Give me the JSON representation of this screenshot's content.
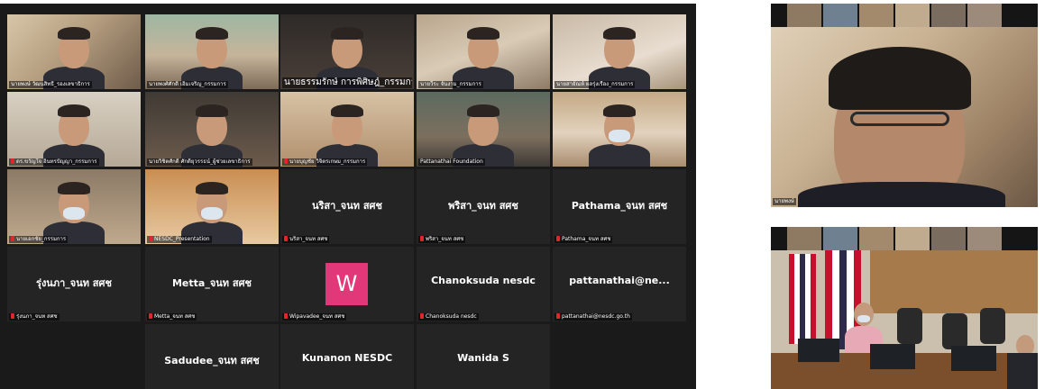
{
  "gallery": {
    "tiles": [
      {
        "type": "video",
        "bg": "vbg-a",
        "name": "นายพงษ์ วัฒนสิทธิ์_รองเลขาธิการ",
        "active": true
      },
      {
        "type": "video",
        "bg": "vbg-b",
        "name": "นายพงศ์ศักดิ์ เอิ่มเจริญ_กรรมการ"
      },
      {
        "type": "video",
        "bg": "vbg-c",
        "name": "นายธรรมรักษ์ การพิศิษฎ์_กรรมการ",
        "big": true
      },
      {
        "type": "video",
        "bg": "vbg-d",
        "name": "นายวีระ จั่นงาม_กรรมการ"
      },
      {
        "type": "video",
        "bg": "vbg-e",
        "name": "นายสายัณห์ ผลรุ่งเรือง_กรรมการ"
      },
      {
        "type": "video",
        "bg": "vbg-f",
        "name": "ดร.ขวัญใจ อินทรปัญญา_กรรมการ",
        "mic": true
      },
      {
        "type": "video",
        "bg": "vbg-g",
        "name": "นายวิชิตศักดิ์ ศักดิ์ยุวรรธน์_ผู้ช่วยเลขาธิการ"
      },
      {
        "type": "video",
        "bg": "vbg-h",
        "name": "นายบุญชัย วิจิตรเกษม_กรรมการ",
        "mic": true
      },
      {
        "type": "video",
        "bg": "vbg-i",
        "name": "Pattanathai Foundation"
      },
      {
        "type": "video",
        "bg": "vbg-j",
        "name": "",
        "masked": true
      },
      {
        "type": "video",
        "bg": "vbg-k",
        "name": "นายเอกชัย_กรรมการ",
        "mic": true,
        "masked": true
      },
      {
        "type": "video",
        "bg": "vbg-l",
        "name": "NESDC_Presentation",
        "mic": true,
        "masked": true
      },
      {
        "type": "name",
        "display": "นริสา_จนท สศช",
        "name": "นริสา_จนท สศช",
        "mic": true
      },
      {
        "type": "name",
        "display": "พริสา_จนท สศช",
        "name": "พริสา_จนท สศช",
        "mic": true
      },
      {
        "type": "name",
        "display": "Pathama_จนท สศช",
        "name": "Pathama_จนท สศช",
        "mic": true
      },
      {
        "type": "name",
        "display": "รุ่งนภา_จนท สศช",
        "name": "รุ่งนภา_จนท สศช",
        "mic": true
      },
      {
        "type": "name",
        "display": "Metta_จนท สศช",
        "name": "Metta_จนท สศช",
        "mic": true
      },
      {
        "type": "avatar",
        "letter": "W",
        "name": "Wipavadee_จนท สศช",
        "mic": true
      },
      {
        "type": "name",
        "display": "Chanoksuda nesdc",
        "name": "Chanoksuda nesdc",
        "mic": true
      },
      {
        "type": "name",
        "display": "pattanathai@ne...",
        "name": "pattanathai@nesdc.go.th",
        "mic": true
      },
      {
        "type": "empty"
      },
      {
        "type": "name",
        "display": "Sadudee_จนท สศช",
        "name": ""
      },
      {
        "type": "name",
        "display": "Kunanon NESDC",
        "name": ""
      },
      {
        "type": "name",
        "display": "Wanida S",
        "name": ""
      },
      {
        "type": "empty"
      }
    ]
  },
  "speaker": {
    "name": "นายพงษ์"
  },
  "room": {
    "label": "●"
  },
  "colors": {
    "active_border": "#b8e04a",
    "mic_muted": "#e0262b",
    "avatar": "#e23778",
    "gallery_bg": "#1a1a1a"
  }
}
